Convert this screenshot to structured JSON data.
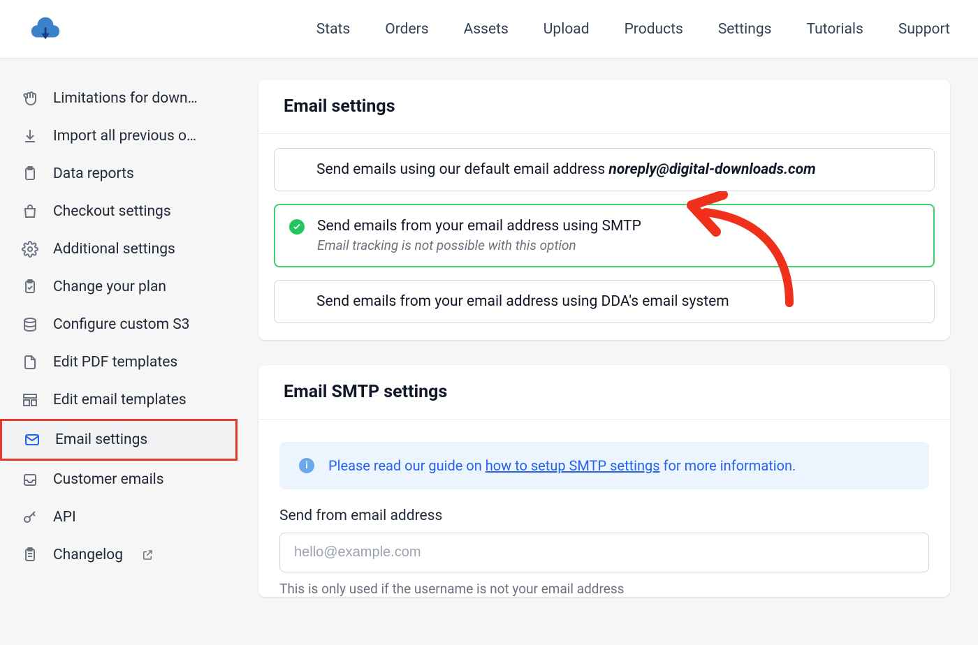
{
  "topnav": {
    "items": [
      {
        "label": "Stats"
      },
      {
        "label": "Orders"
      },
      {
        "label": "Assets"
      },
      {
        "label": "Upload"
      },
      {
        "label": "Products"
      },
      {
        "label": "Settings"
      },
      {
        "label": "Tutorials"
      },
      {
        "label": "Support"
      }
    ]
  },
  "sidebar": {
    "items": [
      {
        "label": "Limitations for down…"
      },
      {
        "label": "Import all previous o…"
      },
      {
        "label": "Data reports"
      },
      {
        "label": "Checkout settings"
      },
      {
        "label": "Additional settings"
      },
      {
        "label": "Change your plan"
      },
      {
        "label": "Configure custom S3"
      },
      {
        "label": "Edit PDF templates"
      },
      {
        "label": "Edit email templates"
      },
      {
        "label": "Email settings"
      },
      {
        "label": "Customer emails"
      },
      {
        "label": "API"
      },
      {
        "label": "Changelog"
      }
    ],
    "active_index": 9
  },
  "card1": {
    "title": "Email settings",
    "options": [
      {
        "title_pre": "Send emails using our default email address ",
        "title_em": "noreply@digital-downloads.com",
        "selected": false
      },
      {
        "title_pre": "Send emails from your email address using SMTP",
        "title_em": "",
        "sub": "Email tracking is not possible with this option",
        "selected": true
      },
      {
        "title_pre": "Send emails from your email address using DDA's email system",
        "title_em": "",
        "selected": false
      }
    ]
  },
  "card2": {
    "title": "Email SMTP settings",
    "info_pre": "Please read our guide on ",
    "info_link": "how to setup SMTP settings",
    "info_post": " for more information.",
    "field_label": "Send from email address",
    "field_placeholder": "hello@example.com",
    "field_help": "This is only used if the username is not your email address"
  }
}
